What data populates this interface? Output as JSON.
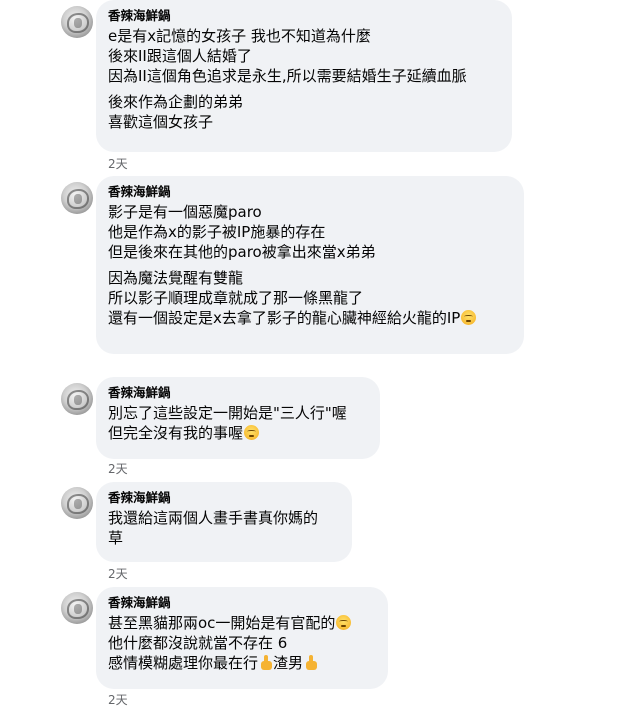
{
  "comments": [
    {
      "author": "香辣海鮮鍋",
      "lines": [
        "e是有x記憶的女孩子 我也不知道為什麼",
        "後來II跟這個人結婚了",
        "因為II這個角色追求是永生,所以需要結婚生子延續血脈",
        "",
        "後來作為企劃的弟弟",
        "喜歡這個女孩子"
      ],
      "time": "2天"
    },
    {
      "author": "香辣海鮮鍋",
      "lines": [
        "影子是有一個惡魔paro",
        "他是作為x的影子被IP施暴的存在",
        "但是後來在其他的paro被拿出來當x弟弟",
        "",
        "因為魔法覺醒有雙龍",
        "所以影子順理成章就成了那一條黑龍了",
        "還有一個設定是x去拿了影子的龍心臟神經給火龍的IP"
      ],
      "time": ""
    },
    {
      "author": "香辣海鮮鍋",
      "lines": [
        "別忘了這些設定一開始是\"三人行\"喔",
        "但完全沒有我的事喔"
      ],
      "time": "2天"
    },
    {
      "author": "香辣海鮮鍋",
      "lines": [
        "我還給這兩個人畫手書真你媽的",
        "草"
      ],
      "time": "2天"
    },
    {
      "author": "香辣海鮮鍋",
      "lines": [
        "甚至黑貓那兩oc一開始是有官配的",
        "他什麼都沒說就當不存在 6",
        "感情模糊處理你最在行",
        "渣男"
      ],
      "time": "2天"
    }
  ],
  "emoji_names": [
    "pensive-face-emoji",
    "thumbs-up-emoji"
  ]
}
